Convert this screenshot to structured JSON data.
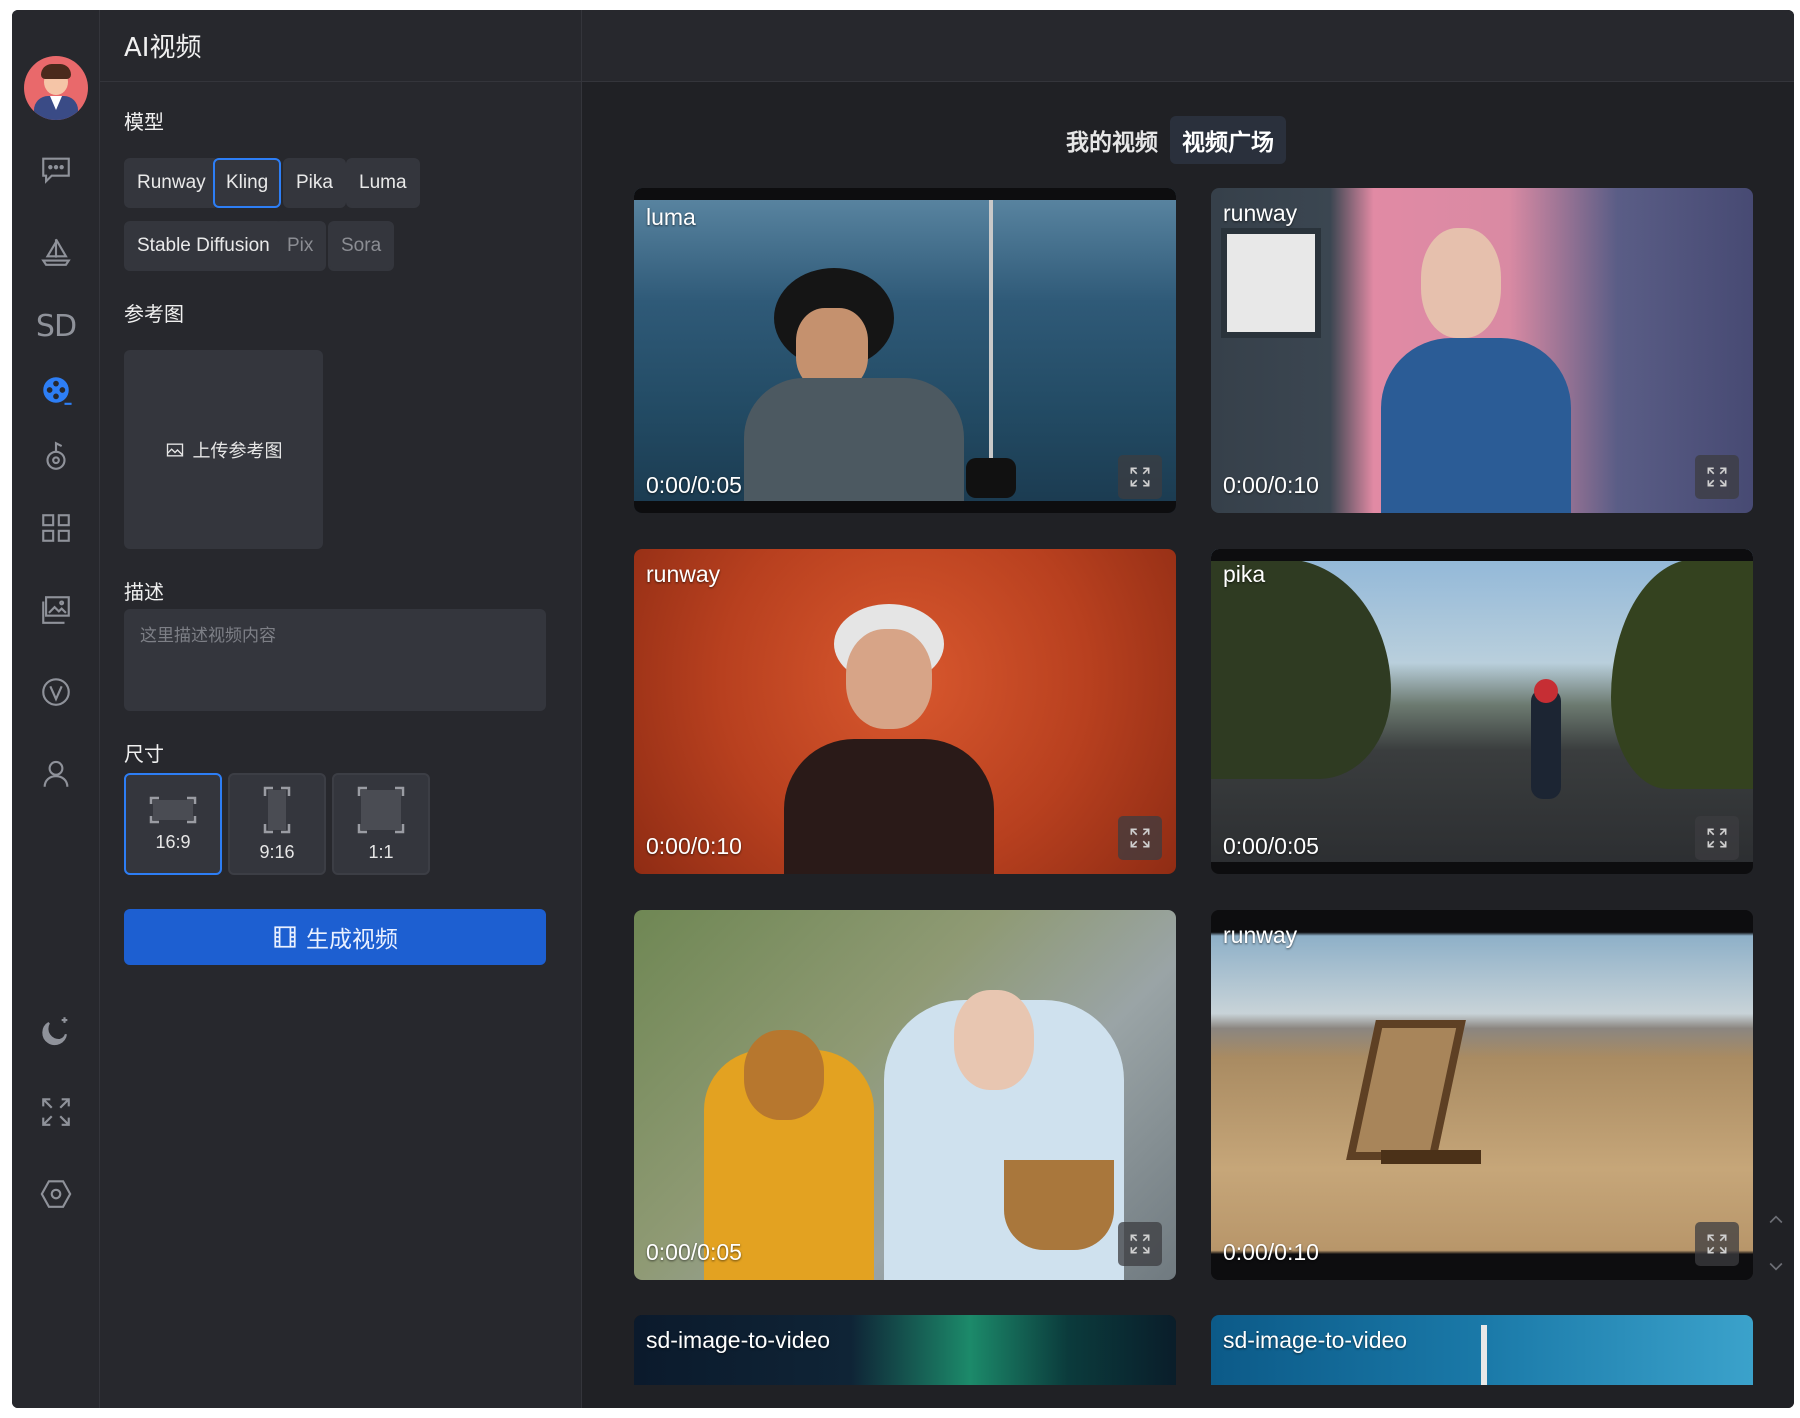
{
  "panel": {
    "title": "AI视频",
    "model_label": "模型",
    "models": [
      {
        "label": "Runway",
        "selected": false,
        "enabled": true
      },
      {
        "label": "Kling",
        "selected": true,
        "enabled": true
      },
      {
        "label": "Pika",
        "selected": false,
        "enabled": true
      },
      {
        "label": "Luma",
        "selected": false,
        "enabled": true
      },
      {
        "label": "Stable Diffusion",
        "selected": false,
        "enabled": true
      },
      {
        "label": "Pix",
        "selected": false,
        "enabled": false
      },
      {
        "label": "Sora",
        "selected": false,
        "enabled": false
      }
    ],
    "reference_label": "参考图",
    "upload_label": "上传参考图",
    "description_label": "描述",
    "description_placeholder": "这里描述视频内容",
    "size_label": "尺寸",
    "ratios": [
      {
        "label": "16:9",
        "selected": true
      },
      {
        "label": "9:16",
        "selected": false
      },
      {
        "label": "1:1",
        "selected": false
      }
    ],
    "generate_label": "生成视频"
  },
  "rail": {
    "items": [
      "chat-icon",
      "sailboat-icon",
      "sd-icon",
      "video-reel-icon",
      "music-note-icon",
      "apps-grid-icon",
      "gallery-icon",
      "v-badge-icon",
      "user-icon"
    ],
    "sd_text": "SD",
    "active": "video-reel-icon",
    "bottom": [
      "theme-moon-icon",
      "fullscreen-icon",
      "settings-hex-icon"
    ]
  },
  "main": {
    "tabs": [
      {
        "label": "我的视频",
        "active": false
      },
      {
        "label": "视频广场",
        "active": true
      }
    ],
    "videos": [
      {
        "model": "luma",
        "time": "0:00/0:05"
      },
      {
        "model": "runway",
        "time": "0:00/0:10"
      },
      {
        "model": "runway",
        "time": "0:00/0:10"
      },
      {
        "model": "pika",
        "time": "0:00/0:05"
      },
      {
        "model": "",
        "time": "0:00/0:05"
      },
      {
        "model": "runway",
        "time": "0:00/0:10"
      },
      {
        "model": "sd-image-to-video",
        "time": ""
      },
      {
        "model": "sd-image-to-video",
        "time": ""
      }
    ]
  },
  "colors": {
    "accent": "#2d7ef5",
    "button": "#1d5fd1",
    "panel_bg": "#27282d",
    "main_bg": "#202125"
  }
}
